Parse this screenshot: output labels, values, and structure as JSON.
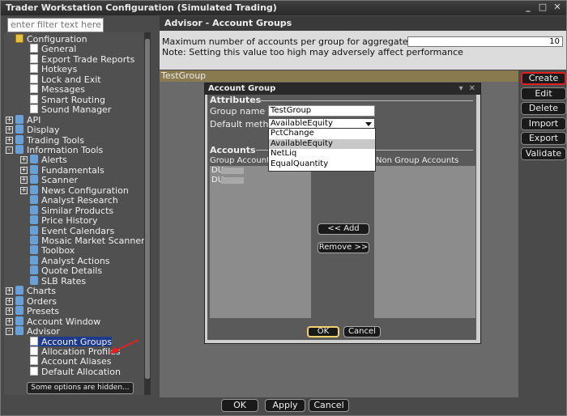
{
  "window": {
    "title": "Trader Workstation Configuration (Simulated Trading)"
  },
  "filter": {
    "placeholder": "enter filter text here"
  },
  "tree": [
    {
      "label": "Configuration",
      "level": 0,
      "icon": "folder-icon"
    },
    {
      "label": "General",
      "level": 1,
      "icon": "page-icon"
    },
    {
      "label": "Export Trade Reports",
      "level": 1,
      "icon": "page-icon"
    },
    {
      "label": "Hotkeys",
      "level": 1,
      "icon": "page-icon"
    },
    {
      "label": "Lock and Exit",
      "level": 1,
      "icon": "page-icon"
    },
    {
      "label": "Messages",
      "level": 1,
      "icon": "page-icon"
    },
    {
      "label": "Smart Routing",
      "level": 1,
      "icon": "page-icon"
    },
    {
      "label": "Sound Manager",
      "level": 1,
      "icon": "page-icon"
    },
    {
      "label": "API",
      "level": 0,
      "icon": "api-icon",
      "expander": "+"
    },
    {
      "label": "Display",
      "level": 0,
      "icon": "display-icon",
      "expander": "+"
    },
    {
      "label": "Trading Tools",
      "level": 0,
      "icon": "trading-tools-icon",
      "expander": "+"
    },
    {
      "label": "Information Tools",
      "level": 0,
      "icon": "information-icon",
      "expander": "-"
    },
    {
      "label": "Alerts",
      "level": 1,
      "icon": "alerts-icon",
      "expander": "+"
    },
    {
      "label": "Fundamentals",
      "level": 1,
      "icon": "fundamentals-icon",
      "expander": "+"
    },
    {
      "label": "Scanner",
      "level": 1,
      "icon": "scanner-icon",
      "expander": "+"
    },
    {
      "label": "News Configuration",
      "level": 1,
      "icon": "news-icon",
      "expander": "+"
    },
    {
      "label": "Analyst Research",
      "level": 1,
      "icon": "research-icon"
    },
    {
      "label": "Similar Products",
      "level": 1,
      "icon": "similar-icon"
    },
    {
      "label": "Price History",
      "level": 1,
      "icon": "price-history-icon"
    },
    {
      "label": "Event Calendars",
      "level": 1,
      "icon": "calendar-icon"
    },
    {
      "label": "Mosaic Market Scanner",
      "level": 1,
      "icon": "scanner-icon"
    },
    {
      "label": "Toolbox",
      "level": 1,
      "icon": "toolbox-icon"
    },
    {
      "label": "Analyst Actions",
      "level": 1,
      "icon": "actions-icon"
    },
    {
      "label": "Quote Details",
      "level": 1,
      "icon": "quote-icon"
    },
    {
      "label": "SLB Rates",
      "level": 1,
      "icon": "rates-icon"
    },
    {
      "label": "Charts",
      "level": 0,
      "icon": "charts-icon",
      "expander": "+"
    },
    {
      "label": "Orders",
      "level": 0,
      "icon": "orders-icon",
      "expander": "+"
    },
    {
      "label": "Presets",
      "level": 0,
      "icon": "presets-icon",
      "expander": "+"
    },
    {
      "label": "Account Window",
      "level": 0,
      "icon": "account-window-icon",
      "expander": "+"
    },
    {
      "label": "Advisor",
      "level": 0,
      "icon": "advisor-icon",
      "expander": "-"
    },
    {
      "label": "Account Groups",
      "level": 1,
      "icon": "page-icon",
      "selected": true
    },
    {
      "label": "Allocation Profiles",
      "level": 1,
      "icon": "page-icon"
    },
    {
      "label": "Account Aliases",
      "level": 1,
      "icon": "page-icon"
    },
    {
      "label": "Default Allocation",
      "level": 1,
      "icon": "page-icon"
    }
  ],
  "hidden_options": "Some options are hidden...",
  "panel": {
    "title": "Advisor - Account Groups",
    "max_accounts_label": "Maximum number of accounts per group for aggregated P&L",
    "max_accounts_value": "10",
    "note": "Note: Setting this value too high may adversely affect performance",
    "group_row": "TestGroup"
  },
  "side_buttons": [
    "Create",
    "Edit",
    "Delete",
    "Import",
    "Export",
    "Validate"
  ],
  "dialog": {
    "title": "Account Group",
    "attributes": "Attributes",
    "group_name_label": "Group name",
    "group_name_value": "TestGroup",
    "method_label": "Default method",
    "method_value": "AvailableEquity",
    "method_options": [
      "PctChange",
      "AvailableEquity",
      "NetLiq",
      "EqualQuantity"
    ],
    "accounts": "Accounts",
    "group_accounts": "Group Accounts",
    "non_group_accounts": "Non Group Accounts",
    "accounts_list": [
      "DU",
      "DU"
    ],
    "add": "<< Add",
    "remove": "Remove >>",
    "ok": "OK",
    "cancel": "Cancel"
  },
  "bottom": {
    "ok": "OK",
    "apply": "Apply",
    "cancel": "Cancel"
  },
  "colors": {
    "highlight": "#e02020",
    "selection": "#1e3a8a"
  }
}
